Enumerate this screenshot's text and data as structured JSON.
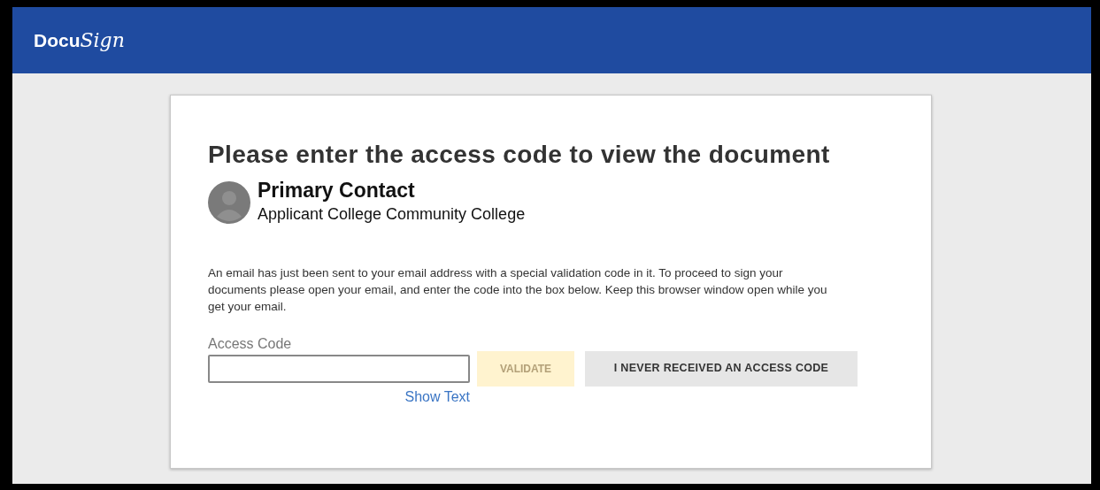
{
  "header": {
    "logo": {
      "plain": "Docu",
      "script": "Sign"
    }
  },
  "card": {
    "title": "Please enter the access code to view the document",
    "recipient": {
      "name": "Primary Contact",
      "organization": "Applicant College Community College"
    },
    "message": "An email has just been sent to your email address with a special validation code in it. To proceed to sign your documents please open your email, and enter the code into the box below. Keep this browser window open while you get your email.",
    "access_code": {
      "label": "Access Code"
    },
    "show_text_link": "Show Text",
    "validate_button": {
      "label": "VALIDATE",
      "disabled": true
    },
    "no_code_button": {
      "label": "I NEVER RECEIVED AN ACCESS CODE"
    }
  }
}
